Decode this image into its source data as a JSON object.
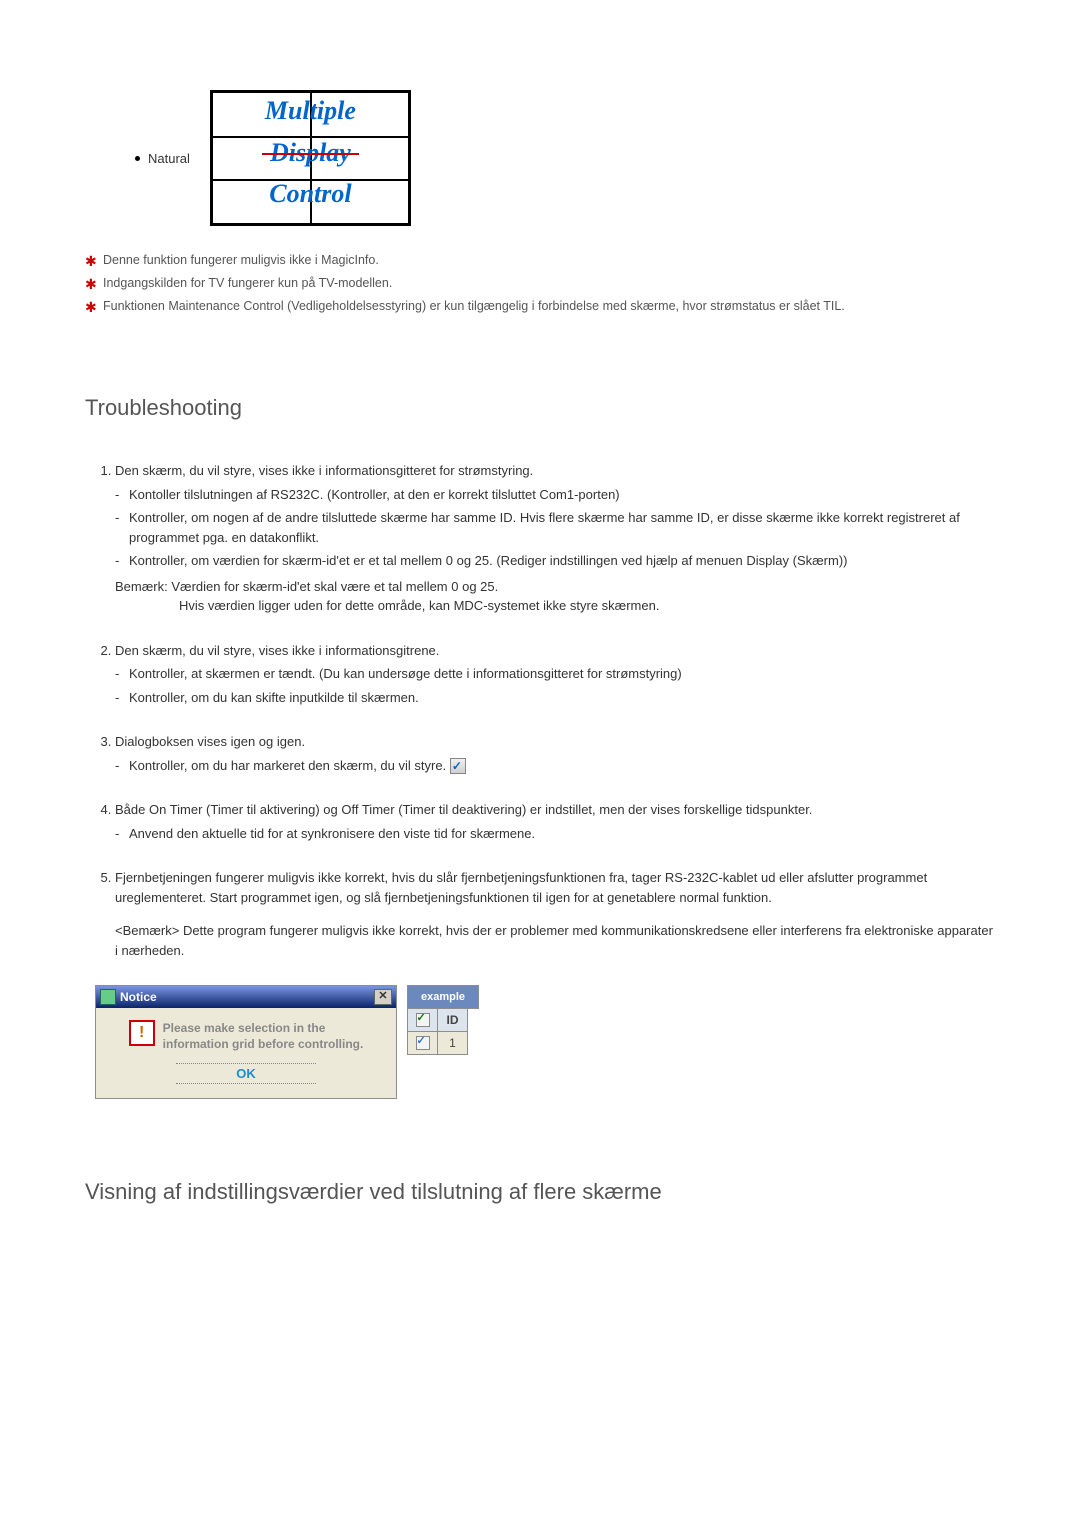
{
  "natural_label": "Natural",
  "logo": {
    "line1": "Multiple",
    "line2": "Display",
    "line3": "Control"
  },
  "star_notes": [
    "Denne funktion fungerer muligvis ikke i MagicInfo.",
    "Indgangskilden for TV fungerer kun på TV-modellen.",
    "Funktionen Maintenance Control (Vedligeholdelsesstyring) er kun tilgængelig i forbindelse med skærme, hvor strømstatus er slået TIL."
  ],
  "sections": {
    "troubleshooting": "Troubleshooting",
    "next": "Visning af indstillingsværdier ved tilslutning af flere skærme"
  },
  "items": {
    "i1": {
      "title": "Den skærm, du vil styre, vises ikke i informationsgitteret for strømstyring.",
      "dashes": [
        "Kontoller tilslutningen af RS232C. (Kontroller, at den er korrekt tilsluttet Com1-porten)",
        "Kontroller, om nogen af de andre tilsluttede skærme har samme ID. Hvis flere skærme har samme ID, er disse skærme ikke korrekt registreret af programmet pga. en datakonflikt.",
        "Kontroller, om værdien for skærm-id'et er et tal mellem 0 og 25. (Rediger indstillingen ved hjælp af menuen Display (Skærm))"
      ],
      "remark_label": "Bemærk:",
      "remark_body": "Værdien for skærm-id'et skal være et tal mellem 0 og 25.",
      "remark_cont": "Hvis værdien ligger uden for dette område, kan MDC-systemet ikke styre skærmen."
    },
    "i2": {
      "title": "Den skærm, du vil styre, vises ikke i informationsgitrene.",
      "dashes": [
        "Kontroller, at skærmen er tændt. (Du kan undersøge dette i informationsgitteret for strømstyring)",
        "Kontroller, om du kan skifte inputkilde til skærmen."
      ]
    },
    "i3": {
      "title": "Dialogboksen vises igen og igen.",
      "dashes": [
        "Kontroller, om du har markeret den skærm, du vil styre."
      ]
    },
    "i4": {
      "title": "Både On Timer (Timer til aktivering) og Off Timer (Timer til deaktivering) er indstillet, men der vises forskellige tidspunkter.",
      "dashes": [
        "Anvend den aktuelle tid for at synkronisere den viste tid for skærmene."
      ]
    },
    "i5": {
      "title": "Fjernbetjeningen fungerer muligvis ikke korrekt, hvis du slår fjernbetjeningsfunktionen fra, tager RS-232C-kablet ud eller afslutter programmet ureglementeret. Start programmet igen, og slå fjernbetjeningsfunktionen til igen for at genetablere normal funktion.",
      "remark2_label": "<Bemærk>",
      "remark2_body": "Dette program fungerer muligvis ikke korrekt, hvis der er problemer med kommunikationskredsene eller interferens fra elektroniske apparater i nærheden."
    }
  },
  "dialog": {
    "title": "Notice",
    "msg1": "Please make selection in the",
    "msg2": "information grid before controlling.",
    "ok": "OK",
    "example": "example",
    "id_header": "ID",
    "id_value": "1"
  }
}
